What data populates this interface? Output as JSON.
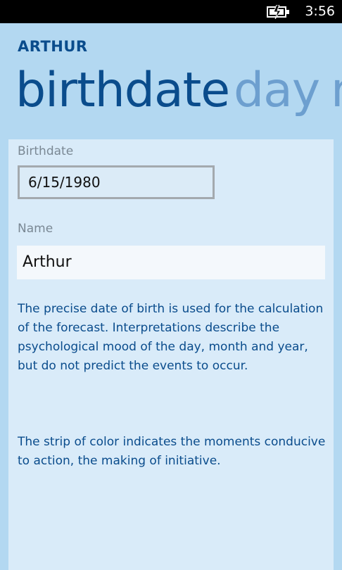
{
  "status_bar": {
    "time": "3:56",
    "battery_icon": "battery-charging-icon"
  },
  "app": {
    "title": "ARTHUR"
  },
  "pivot": {
    "items": [
      "birthdate",
      "day",
      "m"
    ]
  },
  "form": {
    "birthdate_label": "Birthdate",
    "birthdate_value": "6/15/1980",
    "name_label": "Name",
    "name_value": "Arthur"
  },
  "description": {
    "paragraph1": "The precise date of birth is used for the calculation of the forecast. Interpretations describe the psychological mood of the day, month and year, but do not predict the events to occur.",
    "paragraph2": "The strip of color indicates the moments conducive to action, the making of initiative."
  },
  "colors": {
    "background": "#b3d8f1",
    "panel": "#d9ebf9",
    "accent": "#0a4c8c",
    "pivot_inactive": "#6d9fcf"
  }
}
